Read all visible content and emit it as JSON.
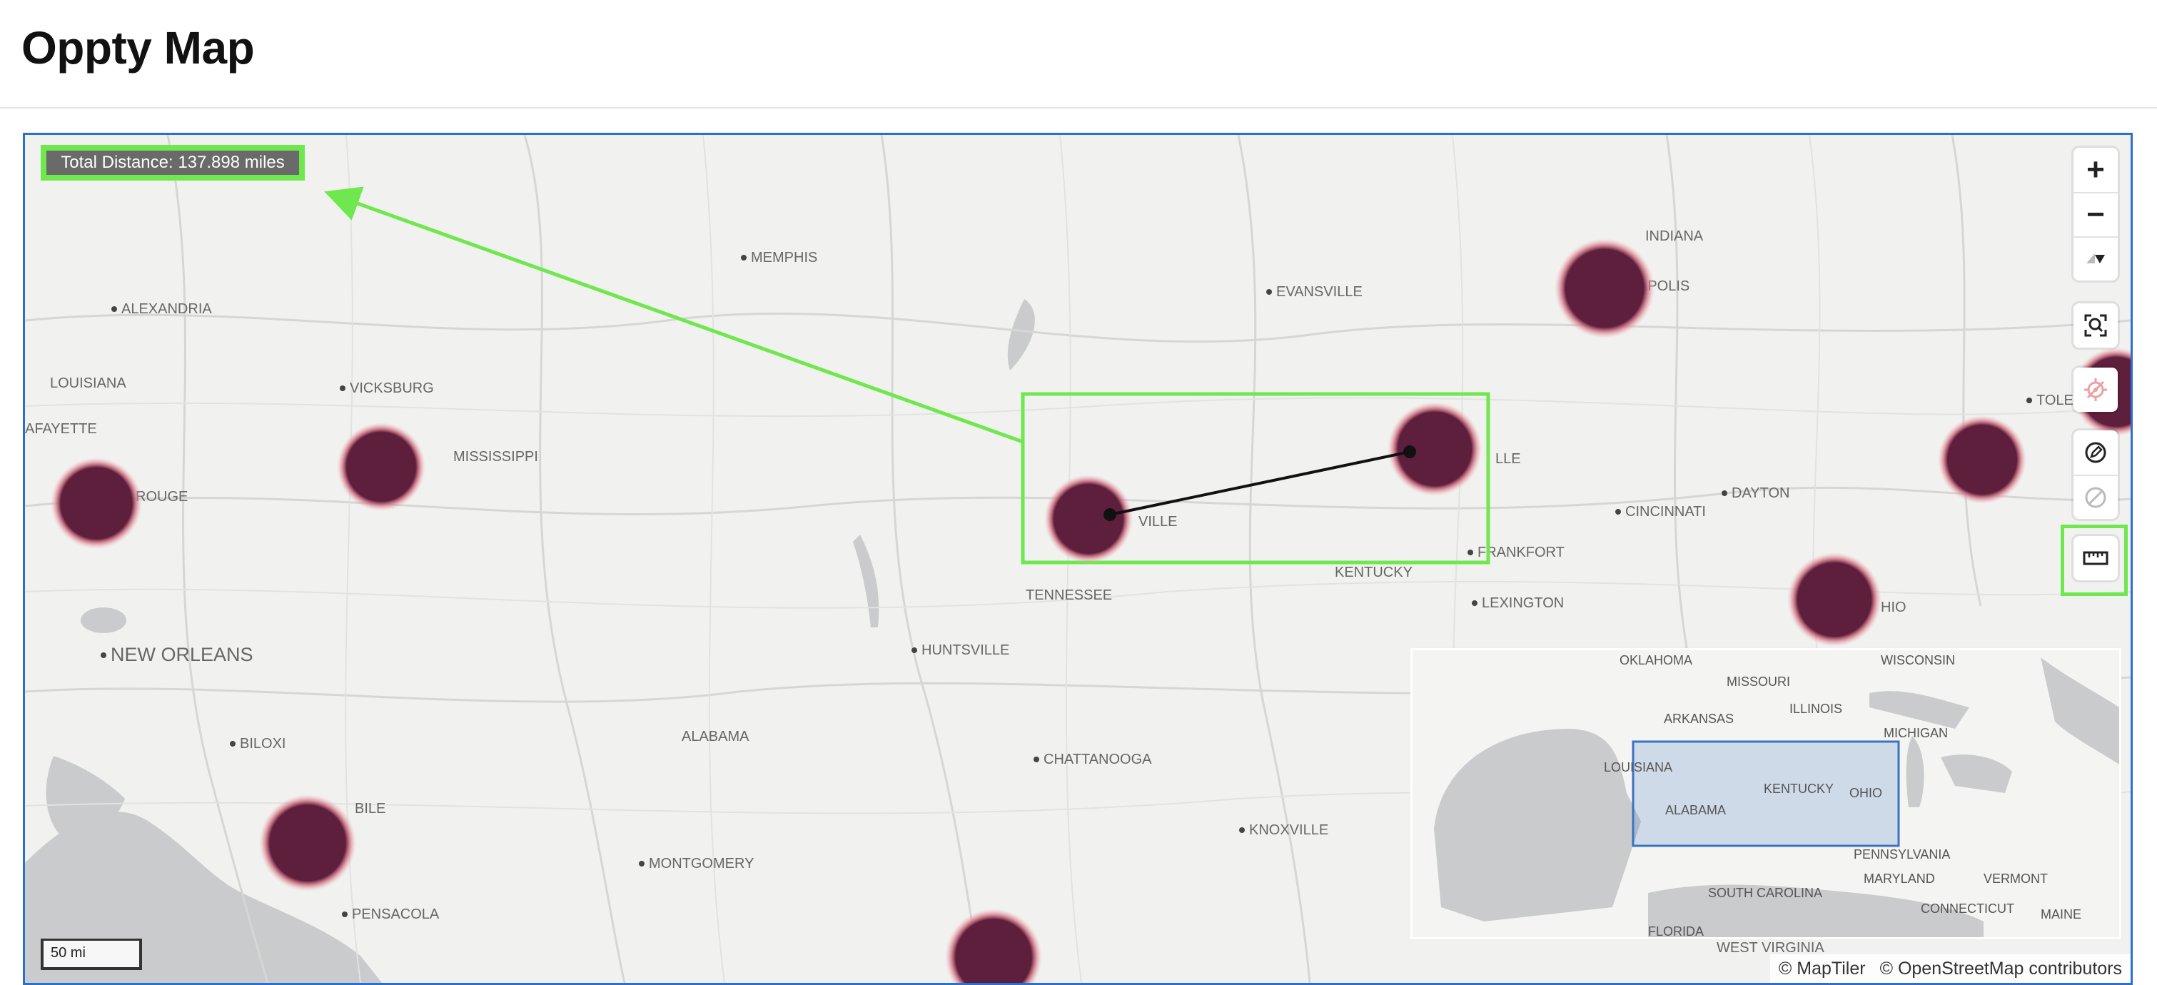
{
  "page": {
    "title": "Oppty Map"
  },
  "map": {
    "total_distance": "Total Distance: 137.898 miles",
    "scale_label": "50 mi",
    "attribution": [
      "© MapTiler",
      "© OpenStreetMap contributors"
    ],
    "labels": {
      "memphis": "MEMPHIS",
      "evansville": "EVANSVILLE",
      "indiana": "INDIANA",
      "apolis": "APOLIS",
      "alexandria": "ALEXANDRIA",
      "louisiana": "LOUISIANA",
      "vicksburg": "VICKSBURG",
      "mississippi": "MISSISSIPPI",
      "afayette": "AFAYETTE",
      "n_rouge": "N ROUGE",
      "ville": "VILLE",
      "lle": "LLE",
      "frankfort": "FRANKFORT",
      "kentucky": "KENTUCKY",
      "tennessee": "TENNESSEE",
      "lexington": "LEXINGTON",
      "cincinnati": "CINCINNATI",
      "dayton": "DAYTON",
      "tole": "TOLE",
      "hio": "HIO",
      "new_orleans": "NEW ORLEANS",
      "huntsville": "HUNTSVILLE",
      "biloxi": "BILOXI",
      "alabama": "ALABAMA",
      "chattanooga": "CHATTANOOGA",
      "bile": "BILE",
      "montgomery": "MONTGOMERY",
      "knoxville": "KNOXVILLE",
      "pensacola": "PENSACOLA"
    },
    "minimap_labels": {
      "oklahoma": "OKLAHOMA",
      "missouri": "MISSOURI",
      "wisconsin": "WISCONSIN",
      "illinois": "ILLINOIS",
      "arkansas": "ARKANSAS",
      "michigan": "MICHIGAN",
      "louisiana": "LOUISIANA",
      "kentucky": "KENTUCKY",
      "ohio": "OHIO",
      "alabama": "ALABAMA",
      "pennsylvania": "PENNSYLVANIA",
      "maryland": "MARYLAND",
      "vermont": "VERMONT",
      "south_carolina": "SOUTH CAROLINA",
      "connecticut": "CONNECTICUT",
      "maine": "MAINE",
      "florida": "FLORIDA",
      "west_virginia": "WEST VIRGINIA"
    },
    "controls": {
      "zoom_in": "+",
      "zoom_out": "−"
    },
    "colors": {
      "marker": "#5e1f3c",
      "marker_glow": "#e98b95",
      "highlight": "#6fe84e",
      "frame": "#2c6fd2",
      "minimap_viewport": "#3b73c2"
    }
  }
}
